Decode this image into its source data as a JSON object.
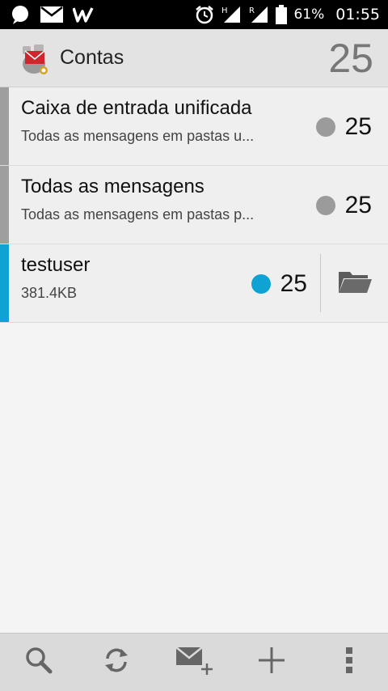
{
  "status_bar": {
    "battery": "61%",
    "time": "01:55",
    "network_h": "H",
    "network_r": "R"
  },
  "action_bar": {
    "title": "Contas",
    "count": "25"
  },
  "accounts": [
    {
      "title": "Caixa de entrada unificada",
      "subtitle": "Todas as mensagens em pastas u...",
      "unread": "25",
      "color": "#9e9e9e"
    },
    {
      "title": "Todas as mensagens",
      "subtitle": "Todas as mensagens em pastas p...",
      "unread": "25",
      "color": "#9e9e9e"
    },
    {
      "title": "testuser",
      "subtitle": "381.4KB",
      "unread": "25",
      "color": "#0fa3d4"
    }
  ],
  "icons": {
    "status_left": [
      "signal-messenger-icon",
      "gmail-icon",
      "w-app-icon"
    ],
    "status_right": [
      "alarm-icon",
      "signal-h-icon",
      "signal-r-icon",
      "battery-icon"
    ],
    "toolbar": [
      "search-icon",
      "refresh-icon",
      "compose-icon",
      "add-icon",
      "overflow-menu-icon"
    ],
    "folder": "folder-icon"
  }
}
